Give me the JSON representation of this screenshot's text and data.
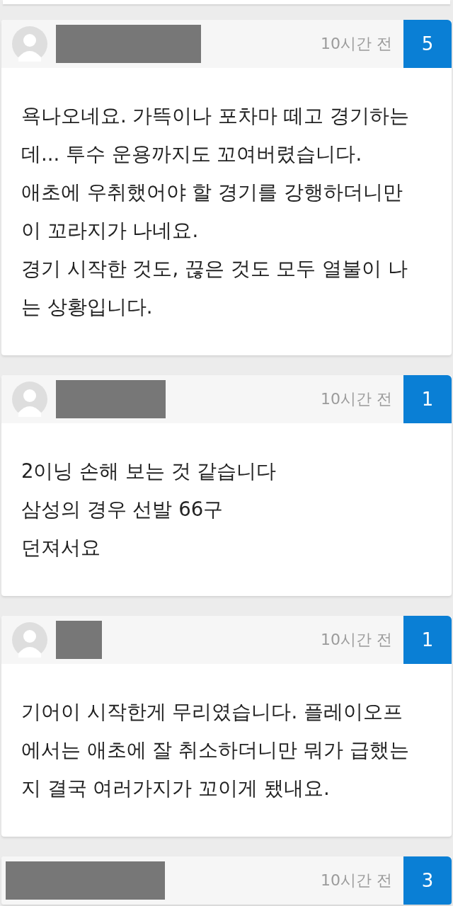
{
  "comments": [
    {
      "avatar": true,
      "time": "10시간 전",
      "count": "5",
      "lines": [
        "욕나오네요. 가뜩이나 포차마 떼고 경기하는",
        "데... 투수 운용까지도 꼬여버렸습니다.",
        "애초에 우취했어야 할 경기를 강행하더니만",
        "이 꼬라지가 나네요.",
        "경기 시작한 것도, 끊은 것도 모두 열불이 나",
        "는 상황입니다."
      ]
    },
    {
      "avatar": true,
      "time": "10시간 전",
      "count": "1",
      "lines": [
        "2이닝 손해 보는 것 같습니다",
        "삼성의 경우  선발 66구",
        "던져서요"
      ]
    },
    {
      "avatar": true,
      "time": "10시간 전",
      "count": "1",
      "lines": [
        "기어이 시작한게 무리였습니다. 플레이오프",
        "에서는 애초에 잘 취소하더니만 뭐가 급했는",
        "지 결국 여러가지가 꼬이게 됐내요."
      ]
    },
    {
      "avatar": false,
      "time": "10시간 전",
      "count": "3"
    }
  ]
}
